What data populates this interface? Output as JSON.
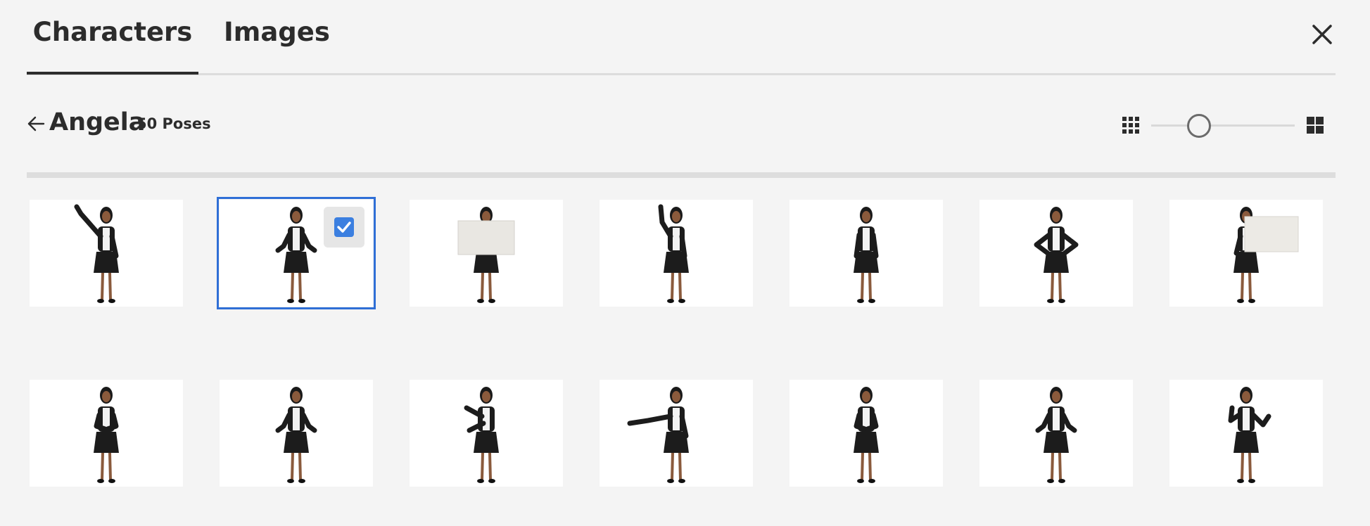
{
  "tabs": [
    {
      "label": "Characters",
      "active": true
    },
    {
      "label": "Images",
      "active": false
    }
  ],
  "icons": {
    "close": "close-icon",
    "back": "arrow-left-icon",
    "small_grid": "small-grid-icon",
    "large_grid": "large-grid-icon",
    "checkbox": "checkbox-checked-icon"
  },
  "header": {
    "character_name": "Angela",
    "pose_count": "50 Poses"
  },
  "thumbnail_size_slider": {
    "value": 0.3
  },
  "colors": {
    "selection": "#2f6fd6",
    "checkbox": "#3b7fe0",
    "background": "#f4f4f4"
  },
  "poses": [
    {
      "row": 1,
      "col": 1,
      "pose": "arm-raised-waving",
      "selected": false
    },
    {
      "row": 1,
      "col": 2,
      "pose": "hands-open",
      "selected": true
    },
    {
      "row": 1,
      "col": 3,
      "pose": "holding-sign",
      "selected": false
    },
    {
      "row": 1,
      "col": 4,
      "pose": "finger-pointing-up",
      "selected": false
    },
    {
      "row": 1,
      "col": 5,
      "pose": "arms-at-sides",
      "selected": false
    },
    {
      "row": 1,
      "col": 6,
      "pose": "hands-on-hips",
      "selected": false
    },
    {
      "row": 1,
      "col": 7,
      "pose": "holding-sign-side",
      "selected": false
    },
    {
      "row": 2,
      "col": 1,
      "pose": "hands-clasped",
      "selected": false
    },
    {
      "row": 2,
      "col": 2,
      "pose": "hands-open-low",
      "selected": false
    },
    {
      "row": 2,
      "col": 3,
      "pose": "presenting-side",
      "selected": false
    },
    {
      "row": 2,
      "col": 4,
      "pose": "arm-extended-left",
      "selected": false
    },
    {
      "row": 2,
      "col": 5,
      "pose": "hands-together",
      "selected": false
    },
    {
      "row": 2,
      "col": 6,
      "pose": "gesturing",
      "selected": false
    },
    {
      "row": 2,
      "col": 7,
      "pose": "fists-raised",
      "selected": false
    }
  ]
}
